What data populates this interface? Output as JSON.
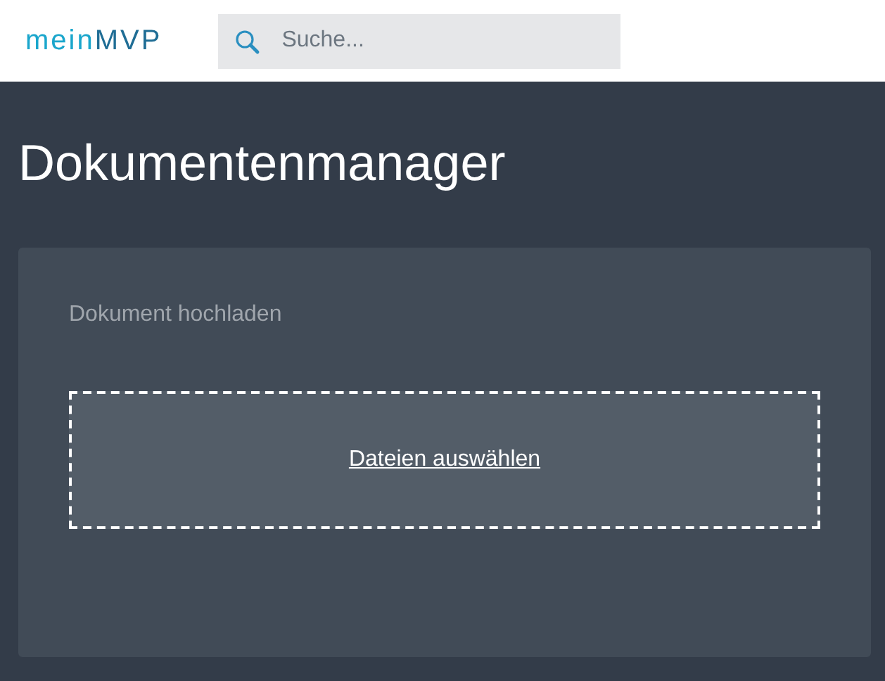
{
  "header": {
    "logo": {
      "first": "mein",
      "second": "MVP"
    },
    "search": {
      "placeholder": "Suche..."
    }
  },
  "page": {
    "title": "Dokumentenmanager"
  },
  "upload": {
    "label": "Dokument hochladen",
    "link": "Dateien auswählen"
  }
}
